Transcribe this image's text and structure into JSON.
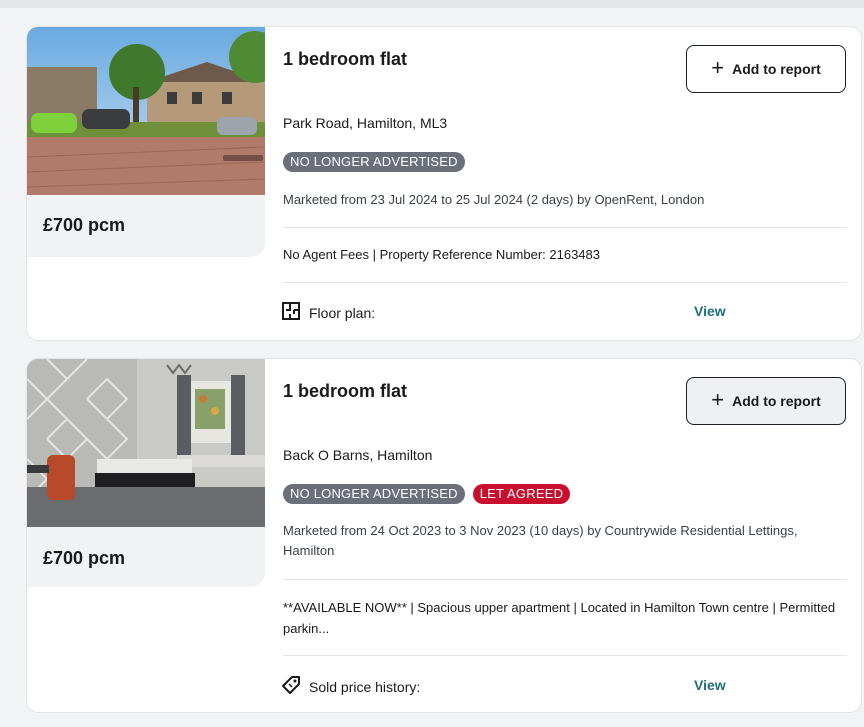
{
  "listings": [
    {
      "title": "1 bedroom flat",
      "add_label": "Add to report",
      "address": "Park Road, Hamilton, ML3",
      "badges": [
        "NO LONGER ADVERTISED"
      ],
      "marketed": "Marketed from 23 Jul 2024 to 25 Jul 2024 (2 days) by OpenRent, London",
      "description": "No Agent Fees | Property Reference Number: 2163483",
      "feature_label": "Floor plan:",
      "feature_icon": "floor-plan-icon",
      "view_label": "View",
      "price": "£700 pcm"
    },
    {
      "title": "1 bedroom flat",
      "add_label": "Add to report",
      "address": "Back O Barns, Hamilton",
      "badges": [
        "NO LONGER ADVERTISED",
        "LET AGREED"
      ],
      "marketed": "Marketed from 24 Oct 2023 to 3 Nov 2023 (10 days) by Countrywide Residential Lettings, Hamilton",
      "description": "**AVAILABLE NOW** | Spacious upper apartment | Located in Hamilton Town centre | Permitted parkin...",
      "feature_label": "Sold price history:",
      "feature_icon": "price-tag-icon",
      "view_label": "View",
      "price": "£700 pcm"
    }
  ],
  "colors": {
    "accent_link": "#1f6f77",
    "badge_grey": "#6b6f7a",
    "badge_red": "#c8102e"
  }
}
